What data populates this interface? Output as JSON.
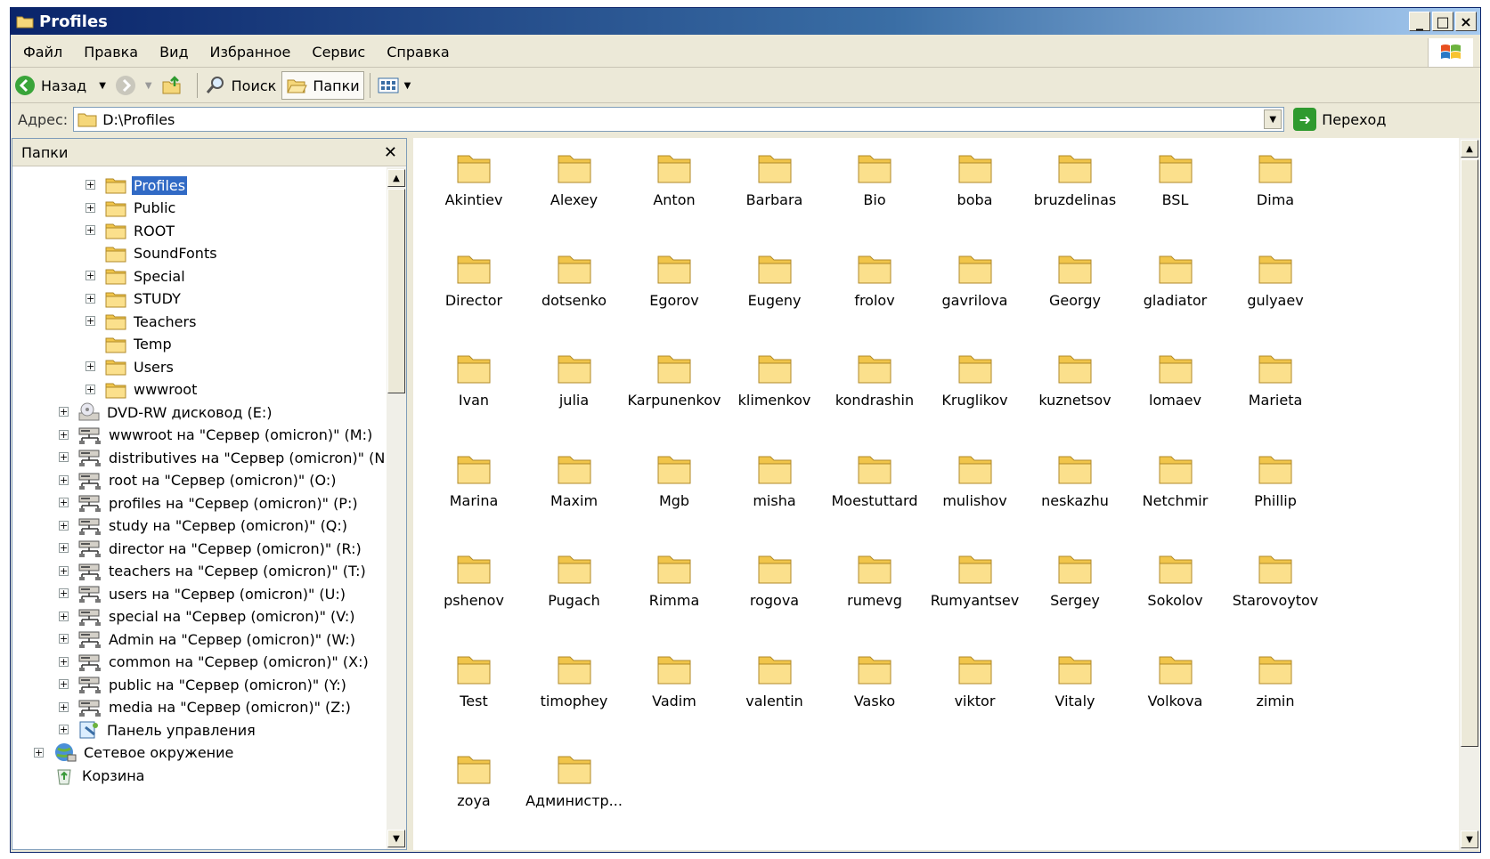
{
  "window": {
    "title": "Profiles",
    "buttons": [
      "_",
      "□",
      "×"
    ]
  },
  "menu": [
    "Файл",
    "Правка",
    "Вид",
    "Избранное",
    "Сервис",
    "Справка"
  ],
  "toolbar": {
    "back": "Назад",
    "search": "Поиск",
    "folders": "Папки"
  },
  "address": {
    "label": "Адрес:",
    "value": "D:\\Profiles",
    "go": "Переход"
  },
  "folders_pane": {
    "title": "Папки",
    "tree": [
      {
        "label": "Profiles",
        "level": 2,
        "expand": true,
        "icon": "folder-icon",
        "selected": true
      },
      {
        "label": "Public",
        "level": 2,
        "expand": true,
        "icon": "folder-icon"
      },
      {
        "label": "ROOT",
        "level": 2,
        "expand": true,
        "icon": "folder-icon"
      },
      {
        "label": "SoundFonts",
        "level": 2,
        "expand": false,
        "icon": "folder-icon"
      },
      {
        "label": "Special",
        "level": 2,
        "expand": true,
        "icon": "folder-icon"
      },
      {
        "label": "STUDY",
        "level": 2,
        "expand": true,
        "icon": "folder-icon"
      },
      {
        "label": "Teachers",
        "level": 2,
        "expand": true,
        "icon": "folder-icon"
      },
      {
        "label": "Temp",
        "level": 2,
        "expand": false,
        "icon": "folder-icon"
      },
      {
        "label": "Users",
        "level": 2,
        "expand": true,
        "icon": "folder-icon"
      },
      {
        "label": "wwwroot",
        "level": 2,
        "expand": true,
        "icon": "folder-icon"
      },
      {
        "label": "DVD-RW дисковод (E:)",
        "level": 1,
        "expand": true,
        "icon": "dvd-drive-icon"
      },
      {
        "label": "wwwroot на \"Сервер (omicron)\" (M:)",
        "level": 1,
        "expand": true,
        "icon": "network-drive-icon"
      },
      {
        "label": "distributives на \"Сервер (omicron)\" (N:)",
        "level": 1,
        "expand": true,
        "icon": "network-drive-icon"
      },
      {
        "label": "root на \"Сервер (omicron)\" (O:)",
        "level": 1,
        "expand": true,
        "icon": "network-drive-icon"
      },
      {
        "label": "profiles на \"Сервер (omicron)\" (P:)",
        "level": 1,
        "expand": true,
        "icon": "network-drive-icon"
      },
      {
        "label": "study на \"Сервер (omicron)\" (Q:)",
        "level": 1,
        "expand": true,
        "icon": "network-drive-icon"
      },
      {
        "label": "director на \"Сервер (omicron)\" (R:)",
        "level": 1,
        "expand": true,
        "icon": "network-drive-icon"
      },
      {
        "label": "teachers на \"Сервер (omicron)\" (T:)",
        "level": 1,
        "expand": true,
        "icon": "network-drive-icon"
      },
      {
        "label": "users на \"Сервер (omicron)\" (U:)",
        "level": 1,
        "expand": true,
        "icon": "network-drive-icon"
      },
      {
        "label": "special на \"Сервер (omicron)\" (V:)",
        "level": 1,
        "expand": true,
        "icon": "network-drive-icon"
      },
      {
        "label": "Admin на \"Сервер (omicron)\" (W:)",
        "level": 1,
        "expand": true,
        "icon": "network-drive-icon"
      },
      {
        "label": "common на \"Сервер (omicron)\" (X:)",
        "level": 1,
        "expand": true,
        "icon": "network-drive-icon"
      },
      {
        "label": "public на \"Сервер (omicron)\" (Y:)",
        "level": 1,
        "expand": true,
        "icon": "network-drive-icon"
      },
      {
        "label": "media на \"Сервер (omicron)\" (Z:)",
        "level": 1,
        "expand": true,
        "icon": "network-drive-icon"
      },
      {
        "label": "Панель управления",
        "level": 1,
        "expand": true,
        "icon": "control-panel-icon"
      },
      {
        "label": "Сетевое окружение",
        "level": 0,
        "expand": true,
        "icon": "network-places-icon"
      },
      {
        "label": "Корзина",
        "level": 0,
        "expand": false,
        "icon": "recycle-bin-icon"
      }
    ]
  },
  "files": [
    "Akintiev",
    "Alexey",
    "Anton",
    "Barbara",
    "Bio",
    "boba",
    "bruzdelinas",
    "BSL",
    "Dima",
    "Director",
    "dotsenko",
    "Egorov",
    "Eugeny",
    "frolov",
    "gavrilova",
    "Georgy",
    "gladiator",
    "gulyaev",
    "Ivan",
    "julia",
    "Karpunenkov",
    "klimenkov",
    "kondrashin",
    "Kruglikov",
    "kuznetsov",
    "lomaev",
    "Marieta",
    "Marina",
    "Maxim",
    "Mgb",
    "misha",
    "Moestuttard",
    "mulishov",
    "neskazhu",
    "Netchmir",
    "Phillip",
    "pshenov",
    "Pugach",
    "Rimma",
    "rogova",
    "rumevg",
    "Rumyantsev",
    "Sergey",
    "Sokolov",
    "Starovoytov",
    "Test",
    "timophey",
    "Vadim",
    "valentin",
    "Vasko",
    "viktor",
    "Vitaly",
    "Volkova",
    "zimin",
    "zoya",
    "Администр..."
  ],
  "colors": {
    "title_start": "#0a246a",
    "title_end": "#a6caf0",
    "selection": "#316ac5",
    "folder": "#f5d77a"
  }
}
